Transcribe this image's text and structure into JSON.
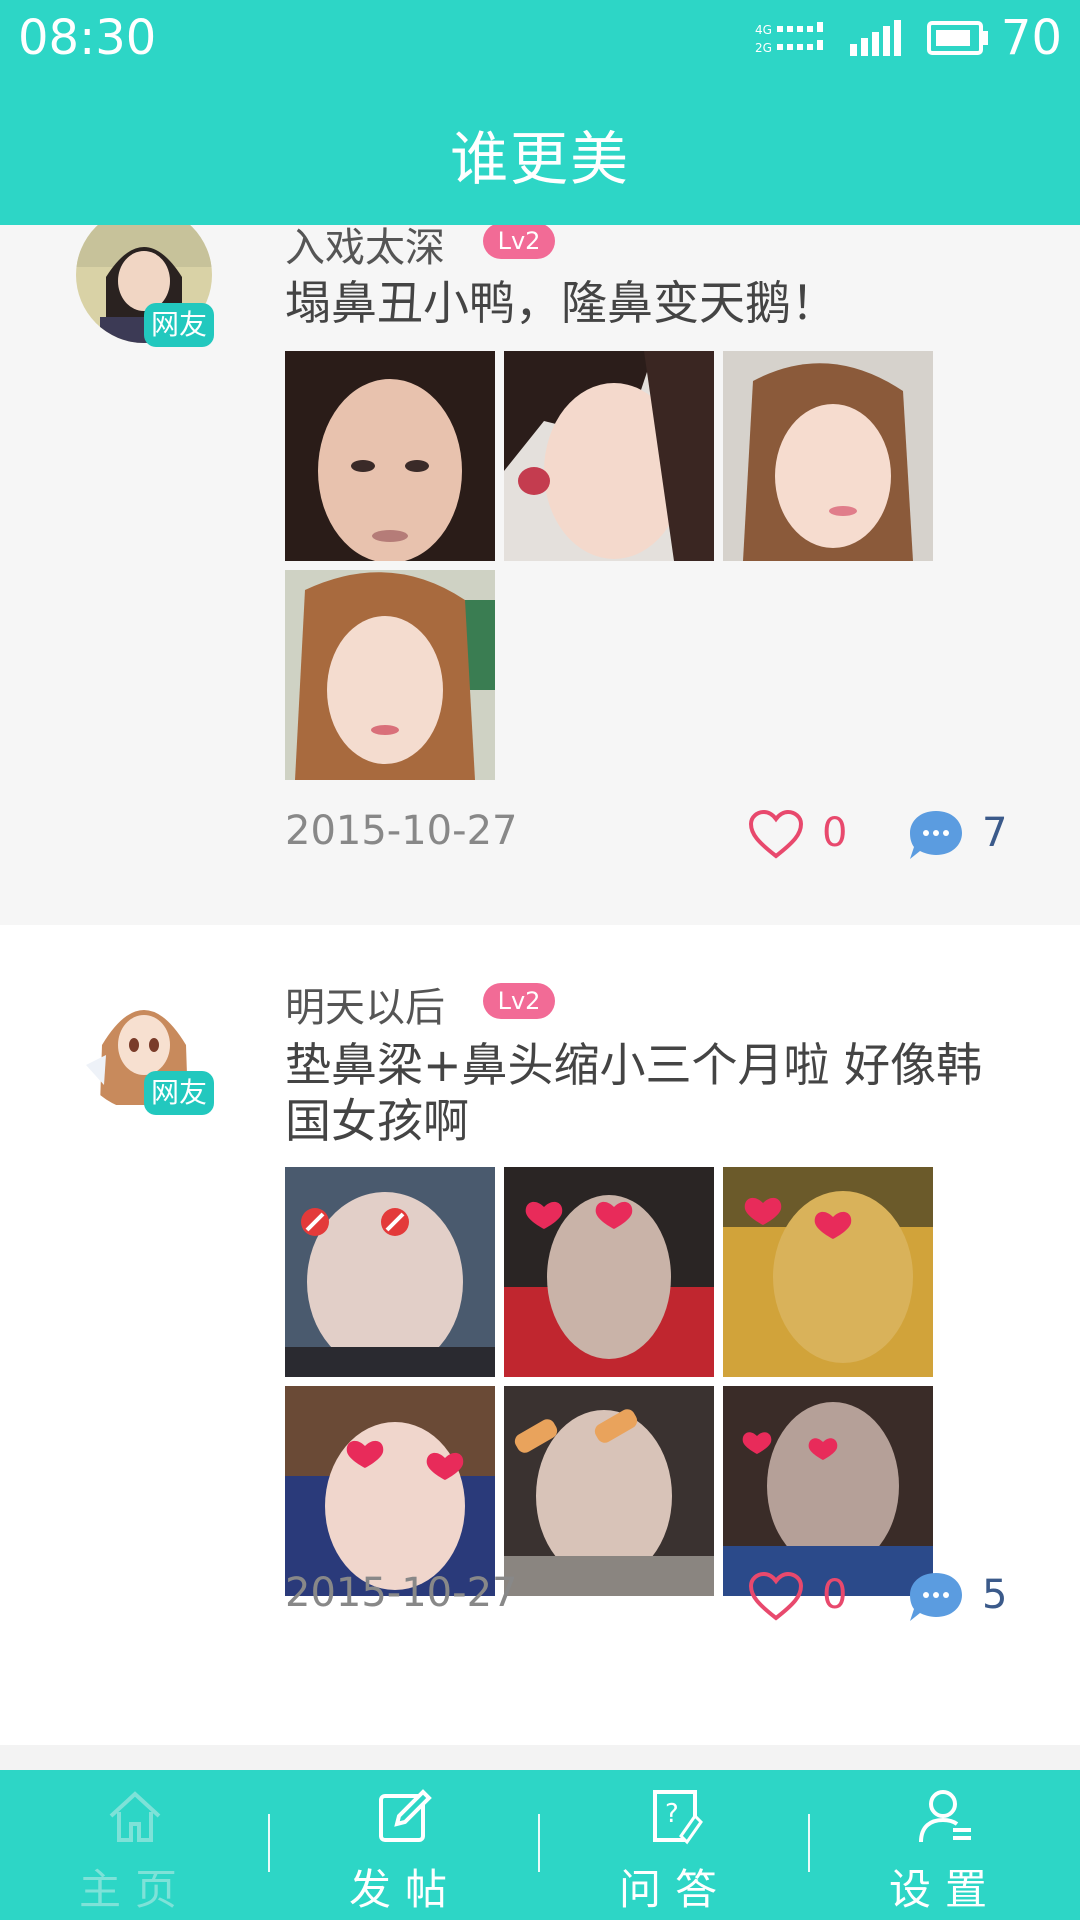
{
  "status_bar": {
    "time": "08:30",
    "network": "4G 2G",
    "battery": "70"
  },
  "header": {
    "title": "谁更美"
  },
  "posts": [
    {
      "username": "入戏太深",
      "level": "Lv2",
      "badge": "网友",
      "text": "塌鼻丑小鸭，隆鼻变天鹅！",
      "image_count": 4,
      "date": "2015-10-27",
      "likes": "0",
      "comments": "7"
    },
    {
      "username": "明天以后",
      "level": "Lv2",
      "badge": "网友",
      "text": "垫鼻梁+鼻头缩小三个月啦 好像韩国女孩啊",
      "image_count": 6,
      "date": "2015-10-27",
      "likes": "0",
      "comments": "5"
    }
  ],
  "bottom_nav": {
    "items": [
      {
        "label": "主页",
        "icon": "home-icon",
        "active": true
      },
      {
        "label": "发帖",
        "icon": "edit-icon"
      },
      {
        "label": "问答",
        "icon": "question-icon"
      },
      {
        "label": "设置",
        "icon": "user-settings-icon"
      }
    ]
  },
  "colors": {
    "brand": "#2dd6c6",
    "level_badge": "#f26b96",
    "like": "#e8496d",
    "comment": "#5b9ce0"
  }
}
